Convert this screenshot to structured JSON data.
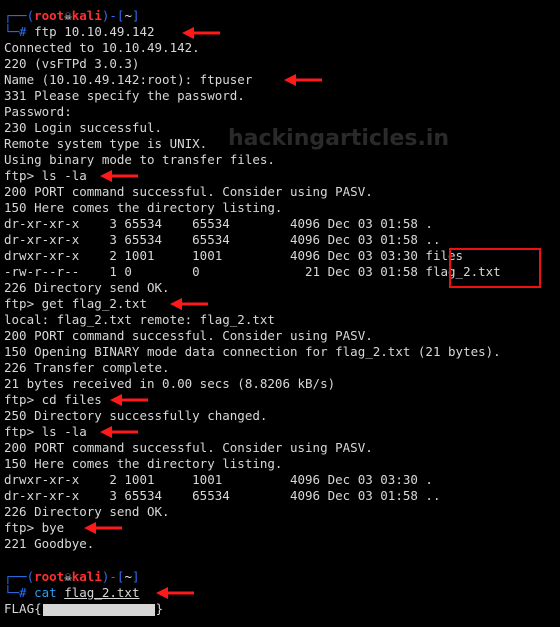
{
  "watermark": "hackingarticles.in",
  "session1": {
    "prompt": {
      "user": "root",
      "icon": "☠",
      "host": "kali",
      "dir": "~"
    },
    "command": "ftp 10.10.49.142",
    "output": [
      "Connected to 10.10.49.142.",
      "220 (vsFTPd 3.0.3)",
      "Name (10.10.49.142:root): ftpuser",
      "331 Please specify the password.",
      "Password:",
      "230 Login successful.",
      "Remote system type is UNIX.",
      "Using binary mode to transfer files.",
      "ftp> ls -la",
      "200 PORT command successful. Consider using PASV.",
      "150 Here comes the directory listing.",
      "dr-xr-xr-x    3 65534    65534        4096 Dec 03 01:58 .",
      "dr-xr-xr-x    3 65534    65534        4096 Dec 03 01:58 ..",
      "drwxr-xr-x    2 1001     1001         4096 Dec 03 03:30 files",
      "-rw-r--r--    1 0        0              21 Dec 03 01:58 flag_2.txt",
      "226 Directory send OK.",
      "ftp> get flag_2.txt",
      "local: flag_2.txt remote: flag_2.txt",
      "200 PORT command successful. Consider using PASV.",
      "150 Opening BINARY mode data connection for flag_2.txt (21 bytes).",
      "226 Transfer complete.",
      "21 bytes received in 0.00 secs (8.8206 kB/s)",
      "ftp> cd files",
      "250 Directory successfully changed.",
      "ftp> ls -la",
      "200 PORT command successful. Consider using PASV.",
      "150 Here comes the directory listing.",
      "drwxr-xr-x    2 1001     1001         4096 Dec 03 03:30 .",
      "dr-xr-xr-x    3 65534    65534        4096 Dec 03 01:58 ..",
      "226 Directory send OK.",
      "ftp> bye",
      "221 Goodbye."
    ]
  },
  "session2": {
    "prompt": {
      "user": "root",
      "icon": "☠",
      "host": "kali",
      "dir": "~"
    },
    "command_name": "cat",
    "command_arg": "flag_2.txt",
    "flag_prefix": "FLAG{",
    "flag_suffix": "}"
  },
  "colors": {
    "prompt": "#2e6ff0",
    "user": "#ff2f2f",
    "annotation": "#ff1a1a"
  }
}
